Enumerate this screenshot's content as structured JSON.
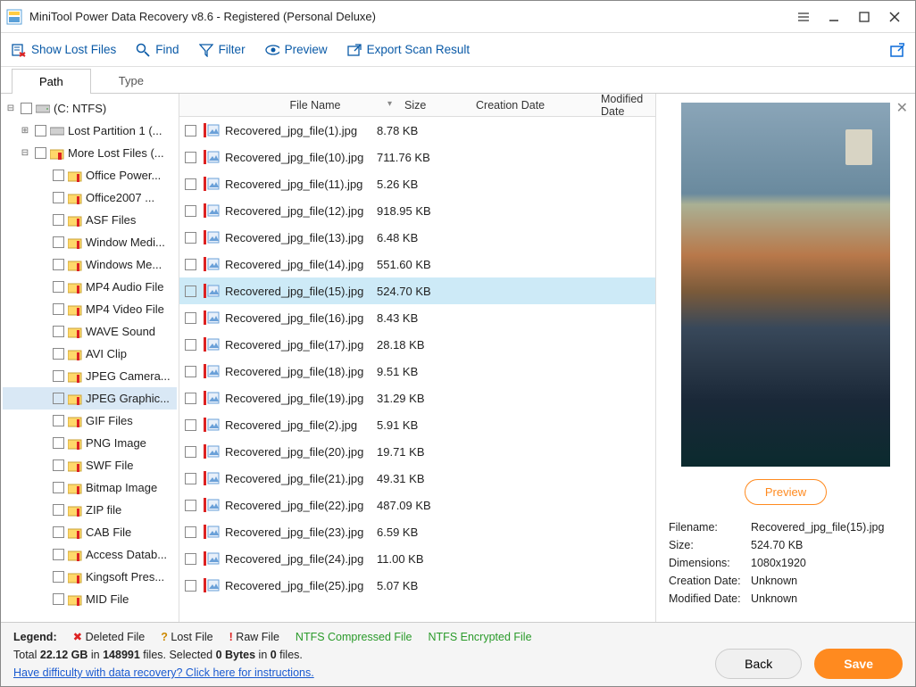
{
  "title": "MiniTool Power Data Recovery v8.6 - Registered (Personal Deluxe)",
  "toolbar": {
    "show_lost": "Show Lost Files",
    "find": "Find",
    "filter": "Filter",
    "preview": "Preview",
    "export": "Export Scan Result"
  },
  "tabs": {
    "path": "Path",
    "type": "Type"
  },
  "tree": {
    "root": "(C: NTFS)",
    "lost_partition": "Lost Partition 1 (...",
    "more_lost": "More Lost Files (...",
    "types": [
      "Office Power...",
      "Office2007 ...",
      "ASF Files",
      "Window Medi...",
      "Windows Me...",
      "MP4 Audio File",
      "MP4 Video File",
      "WAVE Sound",
      "AVI Clip",
      "JPEG Camera...",
      "JPEG Graphic...",
      "GIF Files",
      "PNG Image",
      "SWF File",
      "Bitmap Image",
      "ZIP file",
      "CAB File",
      "Access Datab...",
      "Kingsoft Pres...",
      "MID File"
    ],
    "selected_index": 10
  },
  "columns": {
    "name": "File Name",
    "size": "Size",
    "cdate": "Creation Date",
    "mdate": "Modified Date"
  },
  "files": [
    {
      "name": "Recovered_jpg_file(1).jpg",
      "size": "8.78 KB"
    },
    {
      "name": "Recovered_jpg_file(10).jpg",
      "size": "711.76 KB"
    },
    {
      "name": "Recovered_jpg_file(11).jpg",
      "size": "5.26 KB"
    },
    {
      "name": "Recovered_jpg_file(12).jpg",
      "size": "918.95 KB"
    },
    {
      "name": "Recovered_jpg_file(13).jpg",
      "size": "6.48 KB"
    },
    {
      "name": "Recovered_jpg_file(14).jpg",
      "size": "551.60 KB"
    },
    {
      "name": "Recovered_jpg_file(15).jpg",
      "size": "524.70 KB"
    },
    {
      "name": "Recovered_jpg_file(16).jpg",
      "size": "8.43 KB"
    },
    {
      "name": "Recovered_jpg_file(17).jpg",
      "size": "28.18 KB"
    },
    {
      "name": "Recovered_jpg_file(18).jpg",
      "size": "9.51 KB"
    },
    {
      "name": "Recovered_jpg_file(19).jpg",
      "size": "31.29 KB"
    },
    {
      "name": "Recovered_jpg_file(2).jpg",
      "size": "5.91 KB"
    },
    {
      "name": "Recovered_jpg_file(20).jpg",
      "size": "19.71 KB"
    },
    {
      "name": "Recovered_jpg_file(21).jpg",
      "size": "49.31 KB"
    },
    {
      "name": "Recovered_jpg_file(22).jpg",
      "size": "487.09 KB"
    },
    {
      "name": "Recovered_jpg_file(23).jpg",
      "size": "6.59 KB"
    },
    {
      "name": "Recovered_jpg_file(24).jpg",
      "size": "11.00 KB"
    },
    {
      "name": "Recovered_jpg_file(25).jpg",
      "size": "5.07 KB"
    }
  ],
  "selected_file_index": 6,
  "preview": {
    "button": "Preview",
    "meta": [
      {
        "k": "Filename:",
        "v": "Recovered_jpg_file(15).jpg"
      },
      {
        "k": "Size:",
        "v": "524.70 KB"
      },
      {
        "k": "Dimensions:",
        "v": "1080x1920"
      },
      {
        "k": "Creation Date:",
        "v": "Unknown"
      },
      {
        "k": "Modified Date:",
        "v": "Unknown"
      }
    ]
  },
  "legend": {
    "label": "Legend:",
    "deleted": "Deleted File",
    "lost": "Lost File",
    "raw": "Raw File",
    "compressed": "NTFS Compressed File",
    "encrypted": "NTFS Encrypted File"
  },
  "status": {
    "total_prefix": "Total ",
    "total_size": "22.12 GB",
    "in": " in ",
    "file_count": "148991",
    "files_label": " files.  Selected ",
    "sel_size": "0 Bytes",
    "in2": " in ",
    "sel_count": "0",
    "files2": " files.",
    "help": "Have difficulty with data recovery? Click here for instructions."
  },
  "buttons": {
    "back": "Back",
    "save": "Save"
  }
}
